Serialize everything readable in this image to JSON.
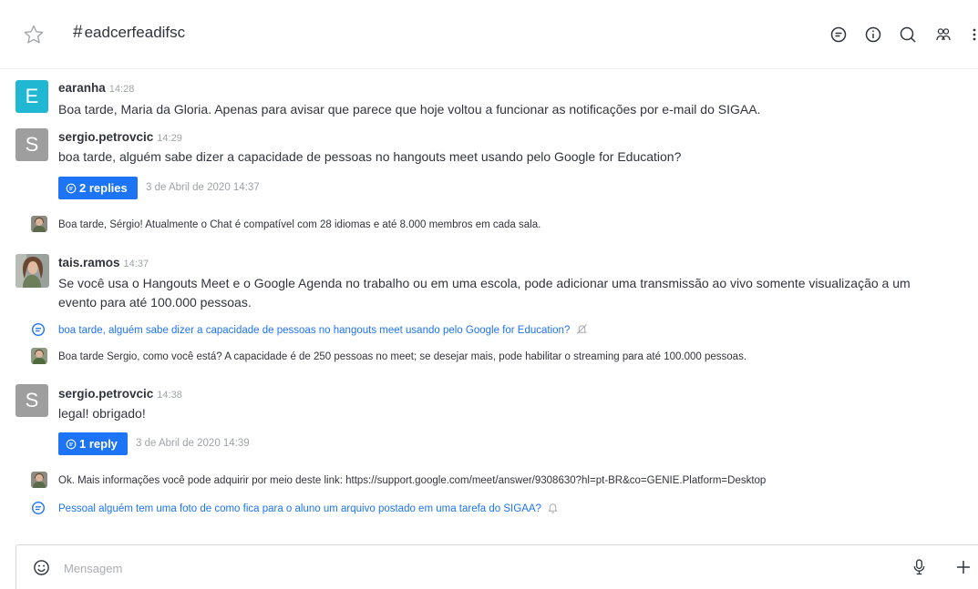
{
  "header": {
    "channel_name": "eadcerfeadifsc",
    "hash": "#"
  },
  "messages": [
    {
      "user": "earanha",
      "time": "14:28",
      "avatar_letter": "E",
      "avatar_color": "#20b7d3",
      "text": "Boa tarde, Maria da Gloria. Apenas para avisar que parece que hoje voltou a funcionar as notificações por e-mail do SIGAA."
    },
    {
      "user": "sergio.petrovcic",
      "time": "14:29",
      "avatar_letter": "S",
      "avatar_color": "#9e9e9e",
      "text": "boa tarde, alguém sabe dizer a capacidade de pessoas no hangouts meet usando pelo Google for Education?",
      "replies_label": "2 replies",
      "replies_date": "3 de Abril de 2020 14:37"
    },
    {
      "text": "Boa tarde, Sérgio! Atualmente o Chat é compatível com 28 idiomas e até 8.000 membros em cada sala."
    },
    {
      "user": "tais.ramos",
      "time": "14:37",
      "text_line1": "Se você usa o Hangouts Meet e o Google Agenda no trabalho ou em uma escola, pode adicionar uma transmissão ao vivo somente visualização a um",
      "text_line2": "evento para até 100.000 pessoas."
    },
    {
      "thread_text": "boa tarde, alguém sabe dizer a capacidade de pessoas no hangouts meet usando pelo Google for Education?"
    },
    {
      "text": "Boa tarde Sergio, como você está? A capacidade é de 250 pessoas no meet; se desejar mais, pode habilitar o streaming para até 100.000 pessoas."
    },
    {
      "user": "sergio.petrovcic",
      "time": "14:38",
      "avatar_letter": "S",
      "avatar_color": "#9e9e9e",
      "text": "legal! obrigado!",
      "replies_label": "1 reply",
      "replies_date": "3 de Abril de 2020 14:39"
    },
    {
      "text": "Ok. Mais informações você pode adquirir por meio deste link: https://support.google.com/meet/answer/9308630?hl=pt-BR&co=GENIE.Platform=Desktop"
    },
    {
      "thread_text": "Pessoal alguém tem uma foto de como fica para o aluno um arquivo postado em uma tarefa do SIGAA?"
    }
  ],
  "composer": {
    "placeholder": "Mensagem"
  },
  "colors": {
    "accent": "#1d74f5",
    "muted": "#9ea2a8"
  }
}
